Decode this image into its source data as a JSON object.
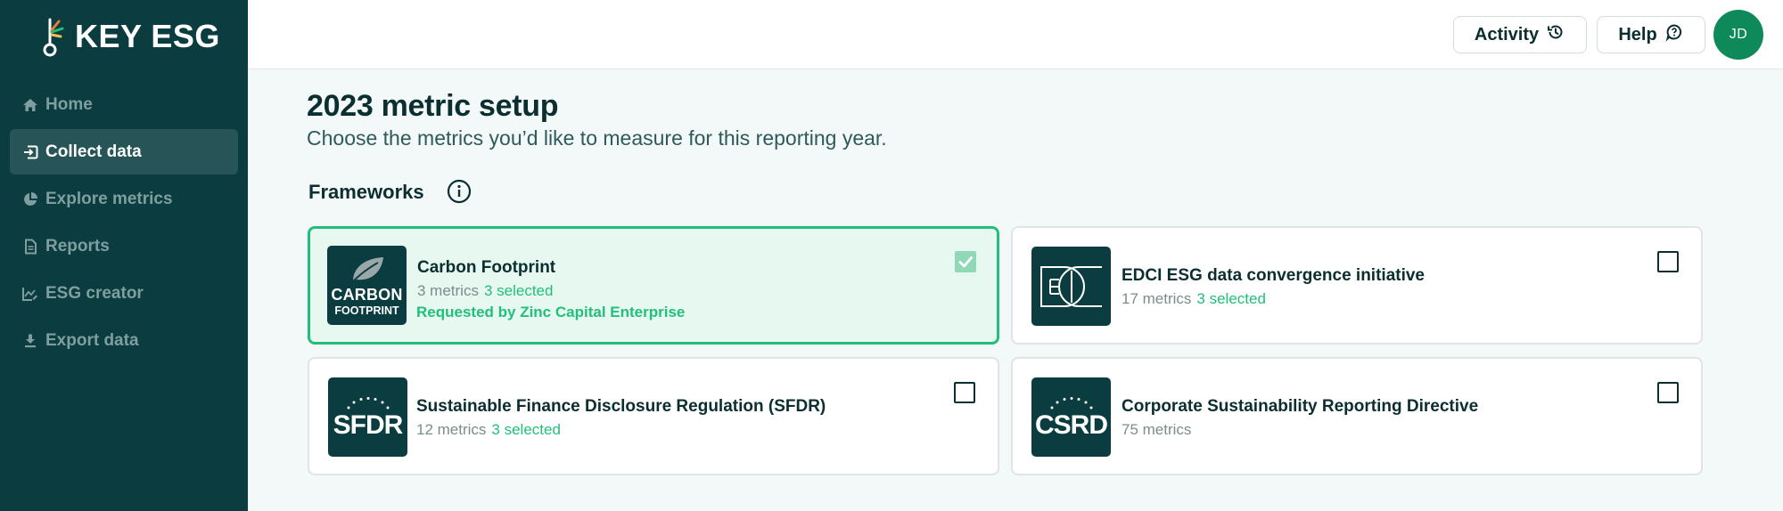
{
  "app": {
    "logo_text": "KEY ESG"
  },
  "colors": {
    "sidebar_bg": "#0b3d40",
    "accent_green": "#22bf7c",
    "avatar_bg": "#0e8a5a",
    "text_dark": "#0b2e30"
  },
  "sidebar": {
    "items": [
      {
        "label": "Home",
        "icon": "home-icon",
        "active": false
      },
      {
        "label": "Collect data",
        "icon": "import-icon",
        "active": true
      },
      {
        "label": "Explore metrics",
        "icon": "pie-chart-icon",
        "active": false
      },
      {
        "label": "Reports",
        "icon": "document-icon",
        "active": false
      },
      {
        "label": "ESG creator",
        "icon": "chart-edit-icon",
        "active": false
      },
      {
        "label": "Export data",
        "icon": "download-icon",
        "active": false
      }
    ]
  },
  "topbar": {
    "activity_label": "Activity",
    "help_label": "Help",
    "avatar_initials": "JD"
  },
  "main": {
    "title": "2023 metric setup",
    "subtitle": "Choose the metrics you’d like to measure for this reporting year.",
    "section_title": "Frameworks"
  },
  "frameworks": [
    {
      "name": "Carbon Footprint",
      "metrics": "3 metrics",
      "selected_text": "3 selected",
      "requested_by": "Requested by Zinc Capital Enterprise",
      "checked": true,
      "logo_line1": "CARBON",
      "logo_line2": "FOOTPRINT"
    },
    {
      "name": "EDCI ESG data convergence initiative",
      "metrics": "17 metrics",
      "selected_text": "3 selected",
      "checked": false
    },
    {
      "name": "Sustainable Finance Disclosure Regulation (SFDR)",
      "metrics": "12 metrics",
      "selected_text": "3 selected",
      "checked": false,
      "logo_text": "SFDR"
    },
    {
      "name": "Corporate Sustainability Reporting Directive",
      "metrics": "75 metrics",
      "checked": false,
      "logo_text": "CSRD"
    }
  ]
}
